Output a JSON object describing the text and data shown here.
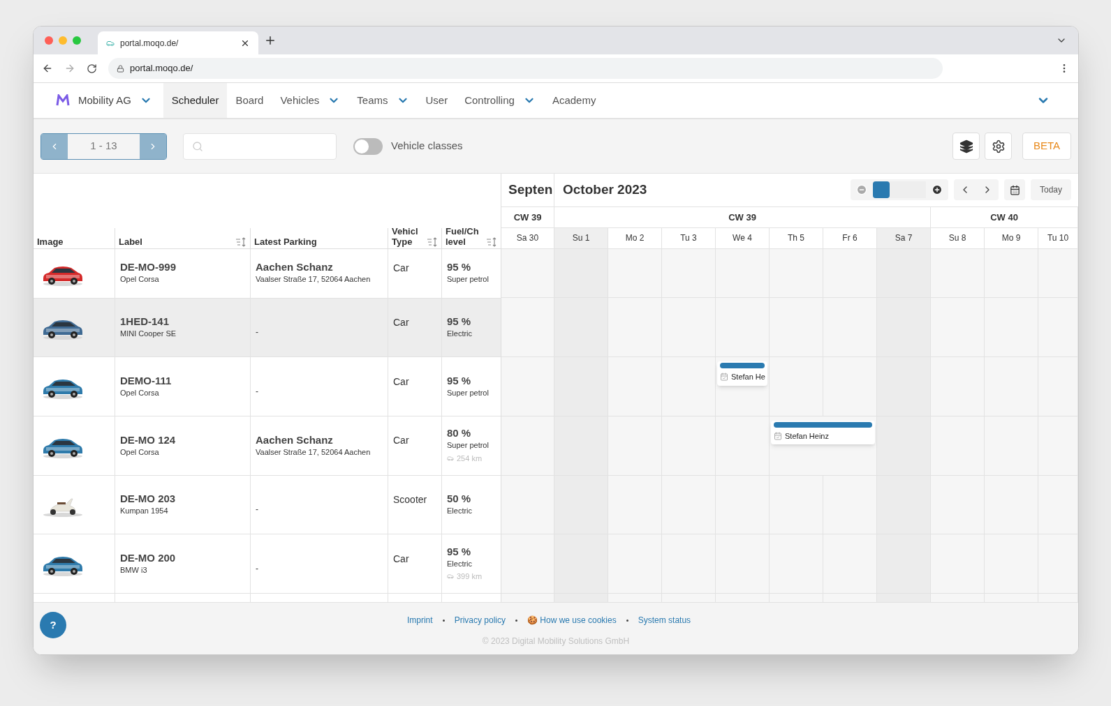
{
  "browser": {
    "tab_title": "portal.moqo.de/",
    "address": "portal.moqo.de/"
  },
  "nav": {
    "org": "Mobility AG",
    "items": [
      {
        "label": "Scheduler",
        "selected": true,
        "dropdown": false
      },
      {
        "label": "Board",
        "selected": false,
        "dropdown": false
      },
      {
        "label": "Vehicles",
        "selected": false,
        "dropdown": true
      },
      {
        "label": "Teams",
        "selected": false,
        "dropdown": true
      },
      {
        "label": "User",
        "selected": false,
        "dropdown": false
      },
      {
        "label": "Controlling",
        "selected": false,
        "dropdown": true
      },
      {
        "label": "Academy",
        "selected": false,
        "dropdown": false
      }
    ]
  },
  "toolbar": {
    "range": "1 - 13",
    "toggle": {
      "label": "Vehicle classes",
      "on": false
    },
    "beta": "BETA"
  },
  "table": {
    "columns": [
      {
        "label": "Image",
        "sortable": false
      },
      {
        "label": "Label",
        "sortable": true
      },
      {
        "label": "Latest Parking",
        "sortable": false
      },
      {
        "label": "Vehicl\nType",
        "sortable": true
      },
      {
        "label": "Fuel/Ch\nlevel",
        "sortable": true
      }
    ],
    "rows": [
      {
        "plate": "DE-MO-999",
        "model": "Opel Corsa",
        "parking": "Aachen Schanz",
        "address": "Vaalser Straße 17, 52064 Aachen",
        "type": "Car",
        "kind": "car",
        "level": "95 %",
        "fuel": "Super petrol",
        "hovered": false
      },
      {
        "plate": "1HED-141",
        "model": "MINI Cooper SE",
        "parking": "-",
        "type": "Car",
        "kind": "car",
        "level": "95 %",
        "fuel": "Electric",
        "hovered": true
      },
      {
        "plate": "DEMO-111",
        "model": "Opel Corsa",
        "parking": "-",
        "type": "Car",
        "kind": "car",
        "level": "95 %",
        "fuel": "Super petrol",
        "hovered": false,
        "booking": "Stefan He",
        "booked": [
          false,
          false,
          false,
          false,
          true,
          false,
          false,
          false,
          false,
          false,
          false
        ]
      },
      {
        "plate": "DE-MO 124",
        "model": "Opel Corsa",
        "parking": "Aachen Schanz",
        "address": "Vaalser Straße 17, 52064 Aachen",
        "type": "Car",
        "kind": "car",
        "level": "80 %",
        "fuel": "Super petrol",
        "range": "254 km",
        "hovered": false,
        "booking": "Stefan Heinz",
        "booked": [
          false,
          false,
          false,
          false,
          false,
          true,
          true,
          false,
          false,
          false,
          false
        ]
      },
      {
        "plate": "DE-MO 203",
        "model": "Kumpan 1954",
        "parking": "-",
        "type": "Scooter",
        "kind": "scooter",
        "level": "50 %",
        "fuel": "Electric",
        "hovered": false
      },
      {
        "plate": "DE-MO 200",
        "model": "BMW i3",
        "parking": "-",
        "type": "Car",
        "kind": "car",
        "level": "95 %",
        "fuel": "Electric",
        "range": "399 km",
        "hovered": false
      }
    ]
  },
  "calendar": {
    "prev_month": "Septen",
    "month": "October 2023",
    "zoom": {
      "level": 0
    },
    "today": "Today",
    "weeks": [
      {
        "label": "CW 39",
        "days": [
          {
            "label": "Sa 30",
            "weekend": false
          }
        ]
      },
      {
        "label": "CW 39",
        "days": [
          {
            "label": "Su 1",
            "weekend": true
          },
          {
            "label": "Mo 2",
            "weekend": false
          },
          {
            "label": "Tu 3",
            "weekend": false
          },
          {
            "label": "We 4",
            "weekend": false
          },
          {
            "label": "Th 5",
            "weekend": false
          },
          {
            "label": "Fr 6",
            "weekend": false
          },
          {
            "label": "Sa 7",
            "weekend": true
          }
        ]
      },
      {
        "label": "CW 40",
        "days": [
          {
            "label": "Su 8",
            "weekend": false
          },
          {
            "label": "Mo 9",
            "weekend": false
          },
          {
            "label": "Tu 10",
            "weekend": false
          }
        ]
      }
    ]
  },
  "footer": {
    "links": [
      "Imprint",
      "Privacy policy",
      "🍪 How we use cookies",
      "System status"
    ],
    "copyright": "© 2023 Digital Mobility Solutions GmbH",
    "help": "?"
  }
}
